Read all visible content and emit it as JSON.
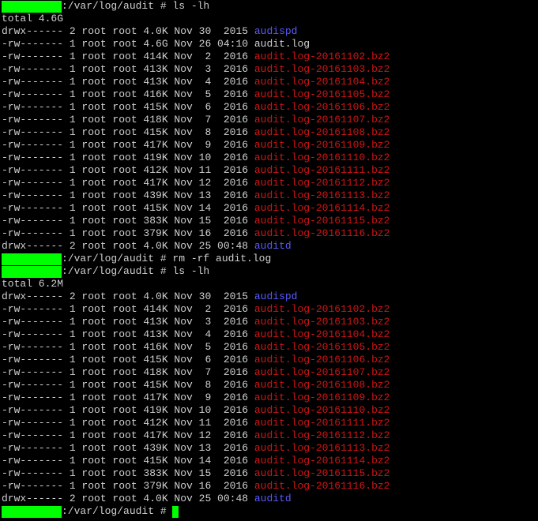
{
  "colors": {
    "background": "#000000",
    "text": "#d0d0d0",
    "prompt_highlight": "#00ff00",
    "directory": "#5a5aff",
    "archive": "#d01515"
  },
  "lines": [
    {
      "kind": "prompt",
      "text": ":/var/log/audit # ls -lh"
    },
    {
      "kind": "plain",
      "text": "total 4.6G"
    },
    {
      "kind": "entry",
      "meta": "drwx------ 2 root root 4.0K Nov 30  2015 ",
      "name": "audispd",
      "type": "dir"
    },
    {
      "kind": "entry",
      "meta": "-rw------- 1 root root 4.6G Nov 26 04:10 ",
      "name": "audit.log",
      "type": "plain"
    },
    {
      "kind": "entry",
      "meta": "-rw------- 1 root root 414K Nov  2  2016 ",
      "name": "audit.log-20161102.bz2",
      "type": "arc"
    },
    {
      "kind": "entry",
      "meta": "-rw------- 1 root root 413K Nov  3  2016 ",
      "name": "audit.log-20161103.bz2",
      "type": "arc"
    },
    {
      "kind": "entry",
      "meta": "-rw------- 1 root root 413K Nov  4  2016 ",
      "name": "audit.log-20161104.bz2",
      "type": "arc"
    },
    {
      "kind": "entry",
      "meta": "-rw------- 1 root root 416K Nov  5  2016 ",
      "name": "audit.log-20161105.bz2",
      "type": "arc"
    },
    {
      "kind": "entry",
      "meta": "-rw------- 1 root root 415K Nov  6  2016 ",
      "name": "audit.log-20161106.bz2",
      "type": "arc"
    },
    {
      "kind": "entry",
      "meta": "-rw------- 1 root root 418K Nov  7  2016 ",
      "name": "audit.log-20161107.bz2",
      "type": "arc"
    },
    {
      "kind": "entry",
      "meta": "-rw------- 1 root root 415K Nov  8  2016 ",
      "name": "audit.log-20161108.bz2",
      "type": "arc"
    },
    {
      "kind": "entry",
      "meta": "-rw------- 1 root root 417K Nov  9  2016 ",
      "name": "audit.log-20161109.bz2",
      "type": "arc"
    },
    {
      "kind": "entry",
      "meta": "-rw------- 1 root root 419K Nov 10  2016 ",
      "name": "audit.log-20161110.bz2",
      "type": "arc"
    },
    {
      "kind": "entry",
      "meta": "-rw------- 1 root root 412K Nov 11  2016 ",
      "name": "audit.log-20161111.bz2",
      "type": "arc"
    },
    {
      "kind": "entry",
      "meta": "-rw------- 1 root root 417K Nov 12  2016 ",
      "name": "audit.log-20161112.bz2",
      "type": "arc"
    },
    {
      "kind": "entry",
      "meta": "-rw------- 1 root root 439K Nov 13  2016 ",
      "name": "audit.log-20161113.bz2",
      "type": "arc"
    },
    {
      "kind": "entry",
      "meta": "-rw------- 1 root root 415K Nov 14  2016 ",
      "name": "audit.log-20161114.bz2",
      "type": "arc"
    },
    {
      "kind": "entry",
      "meta": "-rw------- 1 root root 383K Nov 15  2016 ",
      "name": "audit.log-20161115.bz2",
      "type": "arc"
    },
    {
      "kind": "entry",
      "meta": "-rw------- 1 root root 379K Nov 16  2016 ",
      "name": "audit.log-20161116.bz2",
      "type": "arc"
    },
    {
      "kind": "entry",
      "meta": "drwx------ 2 root root 4.0K Nov 25 00:48 ",
      "name": "auditd",
      "type": "dir"
    },
    {
      "kind": "prompt",
      "text": ":/var/log/audit # rm -rf audit.log"
    },
    {
      "kind": "prompt",
      "text": ":/var/log/audit # ls -lh"
    },
    {
      "kind": "plain",
      "text": "total 6.2M"
    },
    {
      "kind": "entry",
      "meta": "drwx------ 2 root root 4.0K Nov 30  2015 ",
      "name": "audispd",
      "type": "dir"
    },
    {
      "kind": "entry",
      "meta": "-rw------- 1 root root 414K Nov  2  2016 ",
      "name": "audit.log-20161102.bz2",
      "type": "arc"
    },
    {
      "kind": "entry",
      "meta": "-rw------- 1 root root 413K Nov  3  2016 ",
      "name": "audit.log-20161103.bz2",
      "type": "arc"
    },
    {
      "kind": "entry",
      "meta": "-rw------- 1 root root 413K Nov  4  2016 ",
      "name": "audit.log-20161104.bz2",
      "type": "arc"
    },
    {
      "kind": "entry",
      "meta": "-rw------- 1 root root 416K Nov  5  2016 ",
      "name": "audit.log-20161105.bz2",
      "type": "arc"
    },
    {
      "kind": "entry",
      "meta": "-rw------- 1 root root 415K Nov  6  2016 ",
      "name": "audit.log-20161106.bz2",
      "type": "arc"
    },
    {
      "kind": "entry",
      "meta": "-rw------- 1 root root 418K Nov  7  2016 ",
      "name": "audit.log-20161107.bz2",
      "type": "arc"
    },
    {
      "kind": "entry",
      "meta": "-rw------- 1 root root 415K Nov  8  2016 ",
      "name": "audit.log-20161108.bz2",
      "type": "arc"
    },
    {
      "kind": "entry",
      "meta": "-rw------- 1 root root 417K Nov  9  2016 ",
      "name": "audit.log-20161109.bz2",
      "type": "arc"
    },
    {
      "kind": "entry",
      "meta": "-rw------- 1 root root 419K Nov 10  2016 ",
      "name": "audit.log-20161110.bz2",
      "type": "arc"
    },
    {
      "kind": "entry",
      "meta": "-rw------- 1 root root 412K Nov 11  2016 ",
      "name": "audit.log-20161111.bz2",
      "type": "arc"
    },
    {
      "kind": "entry",
      "meta": "-rw------- 1 root root 417K Nov 12  2016 ",
      "name": "audit.log-20161112.bz2",
      "type": "arc"
    },
    {
      "kind": "entry",
      "meta": "-rw------- 1 root root 439K Nov 13  2016 ",
      "name": "audit.log-20161113.bz2",
      "type": "arc"
    },
    {
      "kind": "entry",
      "meta": "-rw------- 1 root root 415K Nov 14  2016 ",
      "name": "audit.log-20161114.bz2",
      "type": "arc"
    },
    {
      "kind": "entry",
      "meta": "-rw------- 1 root root 383K Nov 15  2016 ",
      "name": "audit.log-20161115.bz2",
      "type": "arc"
    },
    {
      "kind": "entry",
      "meta": "-rw------- 1 root root 379K Nov 16  2016 ",
      "name": "audit.log-20161116.bz2",
      "type": "arc"
    },
    {
      "kind": "entry",
      "meta": "drwx------ 2 root root 4.0K Nov 25 00:48 ",
      "name": "auditd",
      "type": "dir"
    },
    {
      "kind": "prompt",
      "text": ":/var/log/audit # ",
      "cursor": true
    }
  ]
}
